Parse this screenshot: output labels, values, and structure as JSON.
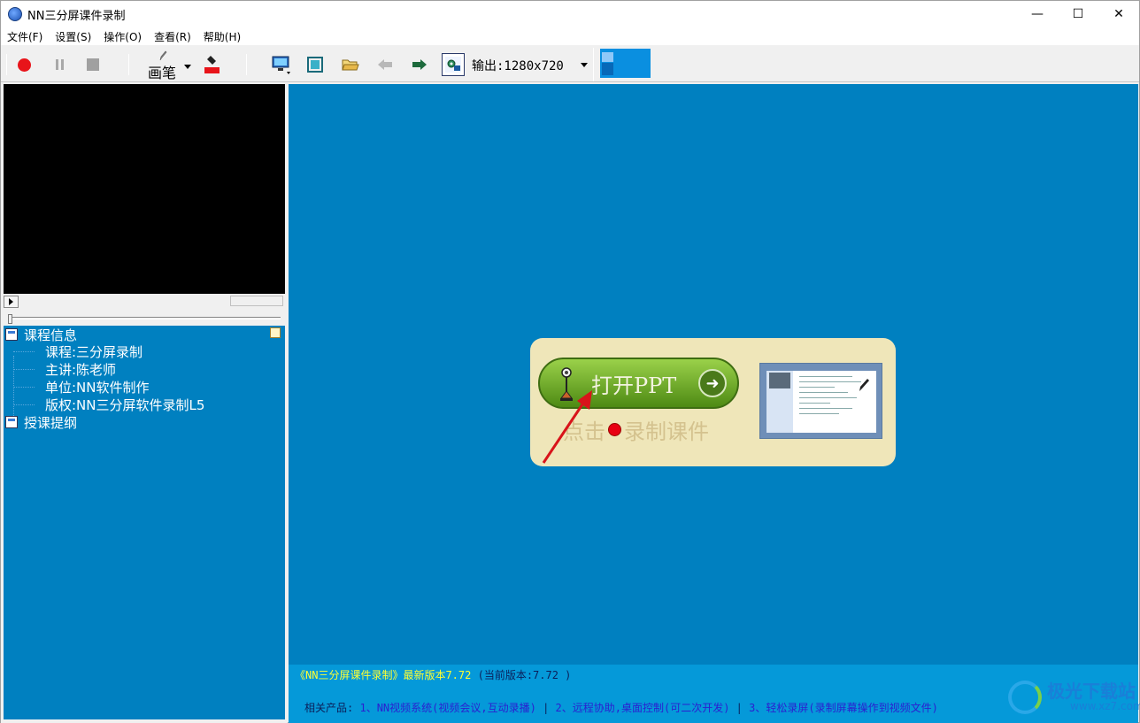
{
  "window": {
    "title": "NN三分屏课件录制",
    "minimize": "—",
    "maximize": "☐",
    "close": "✕"
  },
  "menu": [
    "文件(F)",
    "设置(S)",
    "操作(O)",
    "查看(R)",
    "帮助(H)"
  ],
  "toolbar": {
    "pen_label": "画笔",
    "output_label": "输出:1280x720"
  },
  "tree": {
    "course_info": "课程信息",
    "items": [
      "课程:三分屏录制",
      "主讲:陈老师",
      "单位:NN软件制作",
      "版权:NN三分屏软件录制L5"
    ],
    "outline": "授课提纲"
  },
  "stage": {
    "open_ppt": "打开PPT",
    "hint_before": "点击",
    "hint_after": "录制课件"
  },
  "status": {
    "version_line": "《NN三分屏课件录制》最新版本7.72",
    "current_version": "(当前版本:7.72 )",
    "related_label": "相关产品:",
    "products": [
      "1、NN视频系统(视频会议,互动录播)",
      "2、远程协助,桌面控制(可二次开发)",
      "3、轻松录屏(录制屏幕操作到视频文件)"
    ],
    "divider": "|"
  },
  "watermark": {
    "text": "极光下载站",
    "url": "www.xz7.com"
  },
  "colors": {
    "stage_bg": "#0080c0",
    "status_bg": "#0599d9",
    "record_red": "#e8141a"
  }
}
